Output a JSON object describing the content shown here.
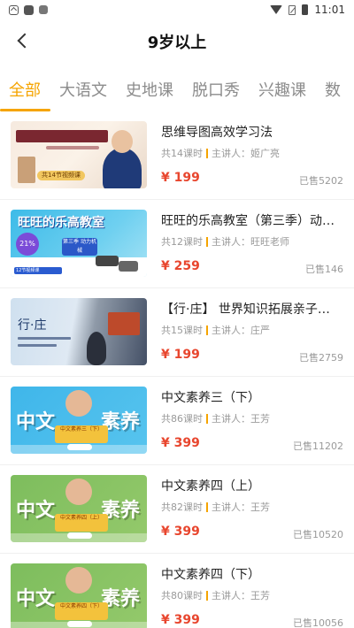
{
  "status_bar": {
    "time": "11:01"
  },
  "nav": {
    "title": "9岁以上"
  },
  "tabs": [
    {
      "label": "全部",
      "active": true
    },
    {
      "label": "大语文"
    },
    {
      "label": "史地课"
    },
    {
      "label": "脱口秀"
    },
    {
      "label": "兴趣课"
    },
    {
      "label": "数"
    }
  ],
  "courses": [
    {
      "title": "思维导图高效学习法",
      "lessons": "共14课时",
      "lecturer_label": "主讲人：",
      "lecturer": "姬广亮",
      "price": "¥ 199",
      "sold": "已售5202",
      "thumb_text": "共14节视频课"
    },
    {
      "title": "旺旺的乐高教室（第三季）动…",
      "lessons": "共12课时",
      "lecturer_label": "主讲人：",
      "lecturer": "旺旺老师",
      "price": "¥ 259",
      "sold": "已售146",
      "thumb_text": "旺旺的乐高教室",
      "thumb_badge": "21%",
      "thumb_box": "第三季 动力机械",
      "thumb_bar": "12节视频课"
    },
    {
      "title": "【行·庄】 世界知识拓展亲子…",
      "lessons": "共15课时",
      "lecturer_label": "主讲人：",
      "lecturer": "庄严",
      "price": "¥ 199",
      "sold": "已售2759",
      "thumb_text": "行·庄"
    },
    {
      "title": "中文素养三（下）",
      "lessons": "共86课时",
      "lecturer_label": "主讲人：",
      "lecturer": "王芳",
      "price": "¥ 399",
      "sold": "已售11202",
      "thumb_word_left": "中文",
      "thumb_word_right": "素养",
      "thumb_ribbon": "中文素养三（下）"
    },
    {
      "title": "中文素养四（上）",
      "lessons": "共82课时",
      "lecturer_label": "主讲人：",
      "lecturer": "王芳",
      "price": "¥ 399",
      "sold": "已售10520",
      "thumb_word_left": "中文",
      "thumb_word_right": "素养",
      "thumb_ribbon": "中文素养四（上）"
    },
    {
      "title": "中文素养四（下）",
      "lessons": "共80课时",
      "lecturer_label": "主讲人：",
      "lecturer": "王芳",
      "price": "¥ 399",
      "sold": "已售10056",
      "thumb_word_left": "中文",
      "thumb_word_right": "素养",
      "thumb_ribbon": "中文素养四（下）"
    }
  ],
  "colors": {
    "accent": "#f5a400",
    "price": "#e8462e"
  }
}
